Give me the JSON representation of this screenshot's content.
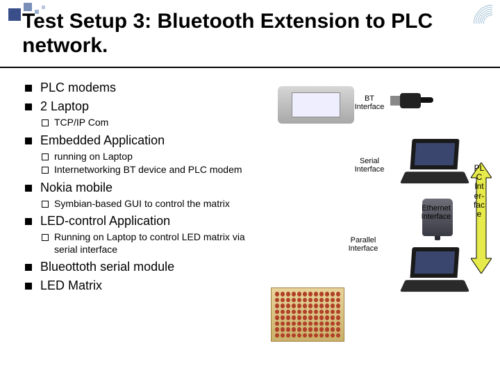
{
  "title": "Test Setup 3: Bluetooth Extension to PLC network.",
  "bullets": {
    "b1": "PLC modems",
    "b2": "2 Laptop",
    "b2_1": "TCP/IP Com",
    "b3": "Embedded Application",
    "b3_1": "running on Laptop",
    "b3_2": "Internetworking BT device and PLC modem",
    "b4": "Nokia mobile",
    "b4_1": "Symbian-based GUI to control the matrix",
    "b5": "LED-control Application",
    "b5_1": "Running on Laptop to control LED matrix via serial interface",
    "b6": "Blueottoth serial module",
    "b7": "LED Matrix"
  },
  "labels": {
    "bt": "BT Interface",
    "serial": "Serial Interface",
    "ethernet": "Ethernet Interface",
    "parallel": "Parallel Interface",
    "plc": "PL C Int er- fac e"
  }
}
